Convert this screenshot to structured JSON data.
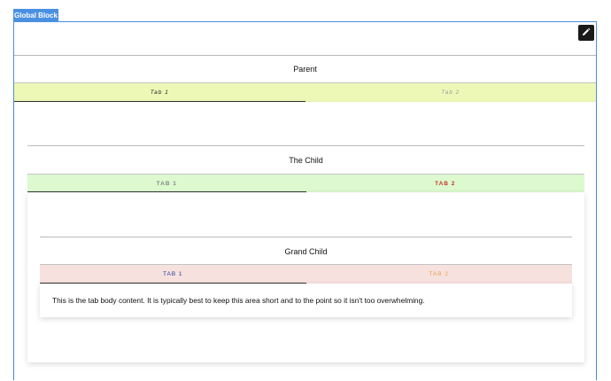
{
  "global_label": "Global Block",
  "parent": {
    "title": "Parent",
    "tabs": [
      {
        "label": "Tab 1"
      },
      {
        "label": "Tab 2"
      }
    ]
  },
  "child": {
    "title": "The Child",
    "tabs": [
      {
        "label": "TAB 1"
      },
      {
        "label": "TAB 2"
      }
    ]
  },
  "grandchild": {
    "title": "Grand Child",
    "tabs": [
      {
        "label": "TAB 1"
      },
      {
        "label": "TAB 2"
      }
    ],
    "body": "This is the tab body content. It is typically best to keep this area short and to the point so it isn't too overwhelming."
  },
  "colors": {
    "accent": "#4a90e2",
    "parent_tabbar": "#eef8b6",
    "child_tabbar": "#dcf9cf",
    "grandchild_tabbar": "#f7e1df",
    "child_tab2_text": "#c0392b",
    "grandchild_tab1_text": "#1f3a93",
    "grandchild_tab2_text": "#e9a24a"
  }
}
